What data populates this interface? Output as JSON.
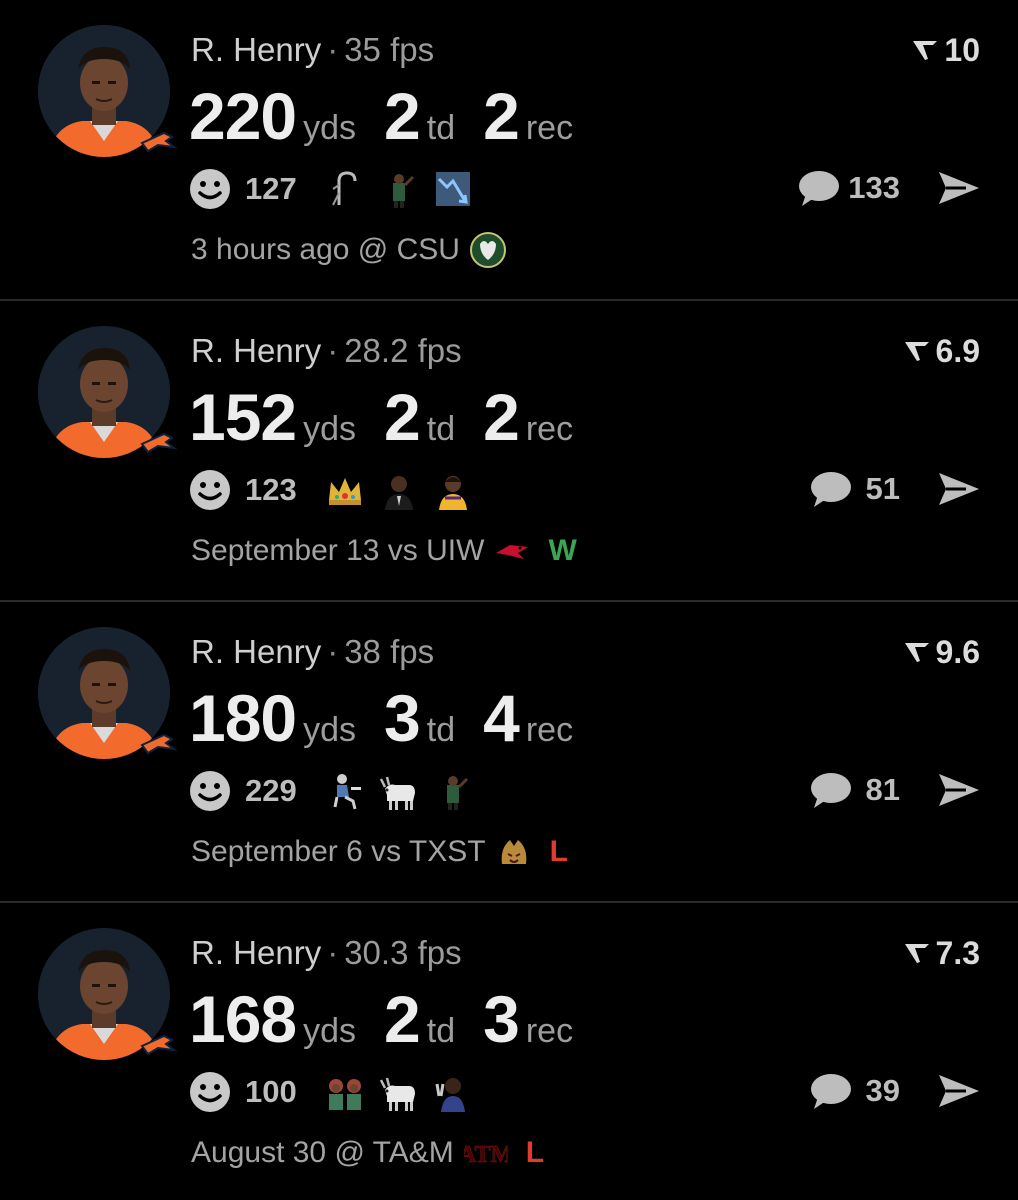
{
  "colors": {
    "background": "#000000",
    "win": "#3aa655",
    "loss": "#e03b2e",
    "text": "#e6e6e6",
    "muted": "#9d9d9d"
  },
  "posts": [
    {
      "player": "R. Henry",
      "fps": "35 fps",
      "rating": "10",
      "yds": "220",
      "yds_label": "yds",
      "td": "2",
      "td_label": "td",
      "rec": "2",
      "rec_label": "rec",
      "reaction_count": "127",
      "emojis": [
        "cane-icon",
        "player-pointing-icon",
        "stock-down-chart-icon"
      ],
      "comments": "133",
      "footer": "3 hours ago @ CSU",
      "opponent_logo": "csu-ram-logo",
      "result": ""
    },
    {
      "player": "R. Henry",
      "fps": "28.2 fps",
      "rating": "6.9",
      "yds": "152",
      "yds_label": "yds",
      "td": "2",
      "td_label": "td",
      "rec": "2",
      "rec_label": "rec",
      "reaction_count": "123",
      "emojis": [
        "crown-icon",
        "man-in-suit-icon",
        "lakers-player-icon"
      ],
      "comments": "51",
      "footer": "September 13 vs UIW",
      "opponent_logo": "uiw-cardinal-logo",
      "result": "W"
    },
    {
      "player": "R. Henry",
      "fps": "38 fps",
      "rating": "9.6",
      "yds": "180",
      "yds_label": "yds",
      "td": "3",
      "td_label": "td",
      "rec": "4",
      "rec_label": "rec",
      "reaction_count": "229",
      "emojis": [
        "person-at-desk-icon",
        "goat-icon",
        "player-pointing-icon"
      ],
      "comments": "81",
      "footer": "September 6 vs TXST",
      "opponent_logo": "txst-bobcat-logo",
      "result": "L"
    },
    {
      "player": "R. Henry",
      "fps": "30.3 fps",
      "rating": "7.3",
      "yds": "168",
      "yds_label": "yds",
      "td": "2",
      "td_label": "td",
      "rec": "3",
      "rec_label": "rec",
      "reaction_count": "100",
      "emojis": [
        "twins-icon",
        "goat-icon",
        "peace-sign-person-icon"
      ],
      "comments": "39",
      "footer": "August 30 @ TA&M",
      "opponent_logo": "tamu-logo",
      "result": "L"
    }
  ]
}
